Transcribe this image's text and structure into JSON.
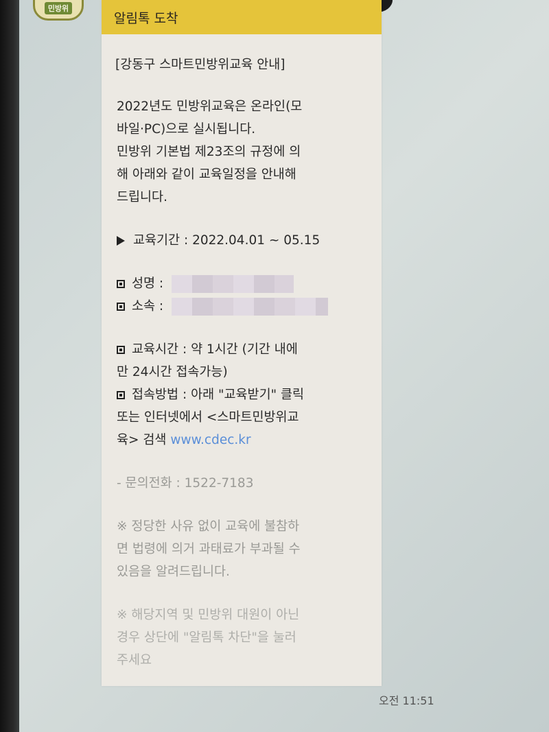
{
  "avatar": {
    "label": "민방위"
  },
  "message": {
    "header": "알림톡 도착",
    "title": "[강동구 스마트민방위교육 안내]",
    "intro_lines": [
      "2022년도 민방위교육은 온라인(모",
      "바일·PC)으로 실시됩니다.",
      "민방위 기본법 제23조의 규정에 의",
      "해 아래와 같이 교육일정을 안내해",
      "드립니다."
    ],
    "period": "교육기간 : 2022.04.01 ~ 05.15",
    "name_label": "성명 :",
    "affiliation_label": "소속 :",
    "duration_lines": [
      "교육시간 : 약 1시간 (기간 내에",
      "만 24시간 접속가능)"
    ],
    "access_lines": [
      "접속방법 : 아래 \"교육받기\" 클릭",
      "또는 인터넷에서 <스마트민방위교",
      "육> 검색 "
    ],
    "link": "www.cdec.kr",
    "inquiry": "- 문의전화 : 1522-7183",
    "notice1_lines": [
      "※ 정당한 사유 없이 교육에 불참하",
      "면 법령에 의거 과태료가 부과될 수",
      "있음을 알려드립니다."
    ],
    "notice2_lines": [
      "※ 해당지역 및 민방위 대원이 아닌",
      "경우 상단에 \"알림톡 차단\"을 눌러",
      "주세요"
    ],
    "time": "오전 11:51"
  },
  "colors": {
    "header_yellow": "#e5c43a",
    "bubble_bg": "#ece9e3",
    "link_blue": "#5a8ed8"
  }
}
